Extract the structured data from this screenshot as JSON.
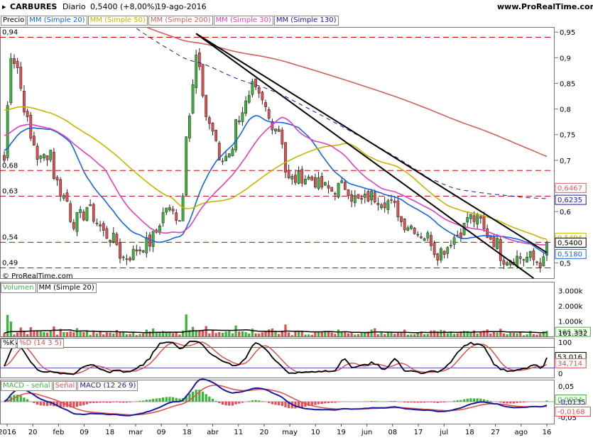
{
  "header": {
    "symbol": "CARBURES",
    "period": "Diario",
    "quote": "0,5400 (+8,00%)",
    "date": "19-ago-2016",
    "site": "www.ProRealTime.com"
  },
  "price_panel": {
    "legend_first": "Precio",
    "legend": [
      {
        "label": "MM (Simple 20)",
        "color": "#1565e0"
      },
      {
        "label": "MM (Simple 50)",
        "color": "#c8b400"
      },
      {
        "label": "MM (Simple 200)",
        "color": "#d06060"
      },
      {
        "label": "MM (Simple 30)",
        "color": "#e040c0"
      },
      {
        "label": "MM (Simple 130)",
        "color": "#1a1aa0"
      }
    ],
    "copyright": "© ProRealTime.com",
    "left_levels": [
      "0,94",
      "0,68",
      "0,63",
      "0,54",
      "0,49"
    ],
    "axis_ticks": [
      "0,95",
      "0,9",
      "0,85",
      "0,8",
      "0,75",
      "0,7",
      "0,65",
      "0,6",
      "0,55",
      "0,5"
    ],
    "value_labels": [
      {
        "text": "0,6467",
        "color": "#d06060"
      },
      {
        "text": "0,6235",
        "color": "#1a1aa0"
      },
      {
        "text": "0,5494",
        "color": "#c8b400"
      },
      {
        "text": "0,5400",
        "color": "#000000"
      },
      {
        "text": "0,5180",
        "color": "#1565e0"
      }
    ]
  },
  "volume_panel": {
    "legend": [
      "Volumen",
      "MM (Simple 20)"
    ],
    "axis_ticks": [
      "3.000k",
      "2.000k",
      "1.000k"
    ],
    "value_labels": [
      "366.387",
      "161.332"
    ]
  },
  "stoch_panel": {
    "legend": [
      "%K",
      "%D (14 3 5)"
    ],
    "axis_ticks": [
      "100",
      "0"
    ],
    "value_labels": [
      "53,016",
      "34,714"
    ]
  },
  "macd_panel": {
    "legend": [
      "MACD - señal",
      "Señal",
      "MACD (12 26 9)"
    ],
    "axis_ticks": [
      "0,05",
      "-0,05"
    ],
    "value_labels": [
      "0,0034",
      "-0,0135",
      "-0,0168"
    ]
  },
  "x_axis": {
    "labels": [
      "2016",
      "20",
      "feb",
      "09",
      "18",
      "mar",
      "09",
      "18",
      "abr",
      "11",
      "20",
      "may",
      "10",
      "19",
      "jun",
      "08",
      "17",
      "jul",
      "18",
      "27",
      "ago",
      "16"
    ]
  },
  "colors": {
    "up": "#3cb43c",
    "down": "#e05050",
    "sma20": "#1565e0",
    "sma50": "#c8b400",
    "sma200": "#d06060",
    "sma30": "#e040c0",
    "sma130": "#1a1aa0",
    "level": "#cc0000"
  },
  "chart_data": {
    "type": "candlestick",
    "title": "CARBURES Diario",
    "y_range": [
      0.47,
      0.96
    ],
    "date_range": [
      "2016-01-04",
      "2016-08-19"
    ],
    "anchors": [
      [
        "2016-01-04",
        0.7
      ],
      [
        "2016-01-06",
        0.91
      ],
      [
        "2016-01-11",
        0.84
      ],
      [
        "2016-01-14",
        0.74
      ],
      [
        "2016-01-19",
        0.7
      ],
      [
        "2016-01-22",
        0.72
      ],
      [
        "2016-01-27",
        0.64
      ],
      [
        "2016-02-02",
        0.58
      ],
      [
        "2016-02-08",
        0.61
      ],
      [
        "2016-02-12",
        0.57
      ],
      [
        "2016-02-17",
        0.55
      ],
      [
        "2016-02-23",
        0.51
      ],
      [
        "2016-03-01",
        0.53
      ],
      [
        "2016-03-07",
        0.55
      ],
      [
        "2016-03-11",
        0.61
      ],
      [
        "2016-03-17",
        0.59
      ],
      [
        "2016-03-22",
        0.8
      ],
      [
        "2016-03-24",
        0.9
      ],
      [
        "2016-03-29",
        0.79
      ],
      [
        "2016-04-04",
        0.69
      ],
      [
        "2016-04-08",
        0.73
      ],
      [
        "2016-04-13",
        0.8
      ],
      [
        "2016-04-18",
        0.84
      ],
      [
        "2016-04-22",
        0.8
      ],
      [
        "2016-04-28",
        0.76
      ],
      [
        "2016-05-03",
        0.66
      ],
      [
        "2016-05-09",
        0.67
      ],
      [
        "2016-05-13",
        0.66
      ],
      [
        "2016-05-20",
        0.64
      ],
      [
        "2016-05-26",
        0.65
      ],
      [
        "2016-06-01",
        0.62
      ],
      [
        "2016-06-07",
        0.63
      ],
      [
        "2016-06-14",
        0.62
      ],
      [
        "2016-06-20",
        0.58
      ],
      [
        "2016-06-24",
        0.57
      ],
      [
        "2016-06-30",
        0.55
      ],
      [
        "2016-07-05",
        0.52
      ],
      [
        "2016-07-12",
        0.55
      ],
      [
        "2016-07-18",
        0.59
      ],
      [
        "2016-07-22",
        0.58
      ],
      [
        "2016-07-27",
        0.55
      ],
      [
        "2016-08-02",
        0.51
      ],
      [
        "2016-08-08",
        0.51
      ],
      [
        "2016-08-12",
        0.51
      ],
      [
        "2016-08-18",
        0.5
      ],
      [
        "2016-08-19",
        0.54
      ]
    ],
    "levels": [
      0.94,
      0.68,
      0.63,
      0.54,
      0.49
    ],
    "trendlines": [
      [
        [
          "2016-03-24",
          0.947
        ],
        [
          "2016-08-15",
          0.44
        ]
      ],
      [
        [
          "2016-03-24",
          0.947
        ],
        [
          "2016-08-19",
          0.52
        ]
      ]
    ],
    "last_values": {
      "close": 0.54,
      "sma20": 0.518,
      "sma50": 0.5494,
      "sma200": 0.6467,
      "sma130": 0.6235
    },
    "volume_last": {
      "volume": 366387,
      "sma20": 161332
    },
    "stochastic_last": {
      "k": 53.016,
      "d": 34.714
    },
    "macd_last": {
      "histogram": 0.0034,
      "signal": -0.0135,
      "macd": -0.0168
    }
  }
}
